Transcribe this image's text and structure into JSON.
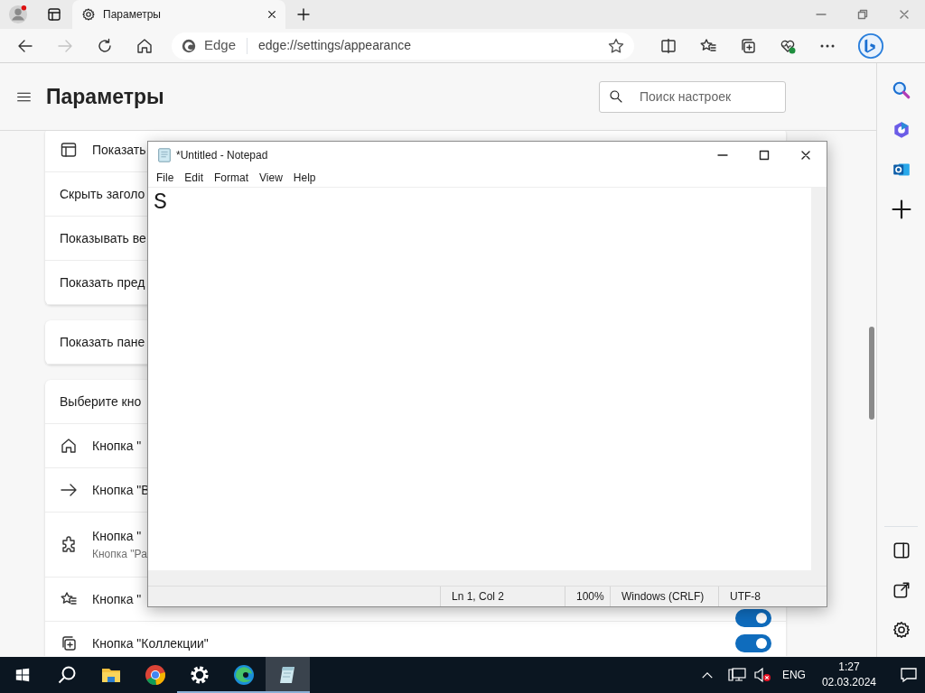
{
  "browser": {
    "tabs": [
      {
        "title": "Параметры",
        "selected": true
      }
    ],
    "nav": {
      "forward_disabled": true
    },
    "address": {
      "site_label": "Edge",
      "url": "edge://settings/appearance"
    }
  },
  "settings": {
    "title": "Параметры",
    "search": {
      "placeholder": "Поиск настроек"
    },
    "groups": [
      {
        "rows": [
          {
            "kind": "window",
            "label": "Показать"
          },
          {
            "label": "Скрыть заголо"
          },
          {
            "label": "Показывать ве"
          },
          {
            "label": "Показать пред"
          }
        ]
      },
      {
        "rows": [
          {
            "label": "Показать пане"
          }
        ]
      },
      {
        "rows": [
          {
            "label": "Выберите кно"
          },
          {
            "kind": "home",
            "label": "Кнопка \""
          },
          {
            "kind": "arrow",
            "label": "Кнопка \"В"
          },
          {
            "kind": "puzzle",
            "label": "Кнопка \"",
            "description": "Кнопка \"Ра"
          },
          {
            "kind": "star",
            "label": "Кнопка \"",
            "toggle_on": true
          },
          {
            "kind": "collections",
            "label": "Кнопка \"Коллекции\"",
            "toggle_on": true
          }
        ]
      }
    ]
  },
  "notepad": {
    "title": "*Untitled - Notepad",
    "menu": [
      "File",
      "Edit",
      "Format",
      "View",
      "Help"
    ],
    "text": "S",
    "status": [
      "Ln 1, Col 2",
      "100%",
      "Windows (CRLF)",
      "UTF-8"
    ]
  },
  "taskbar": {
    "apps": [
      {
        "kind": "folder",
        "running": false,
        "selected": false
      },
      {
        "kind": "ball",
        "running": false,
        "selected": false
      },
      {
        "kind": "gear",
        "running": true,
        "selected": false
      },
      {
        "kind": "wave",
        "running": true,
        "selected": false
      },
      {
        "kind": "notepad",
        "running": true,
        "selected": true
      }
    ],
    "tray": {
      "sound_muted": true,
      "language": "ENG",
      "time": "1:27",
      "date": "02.03.2024"
    }
  }
}
